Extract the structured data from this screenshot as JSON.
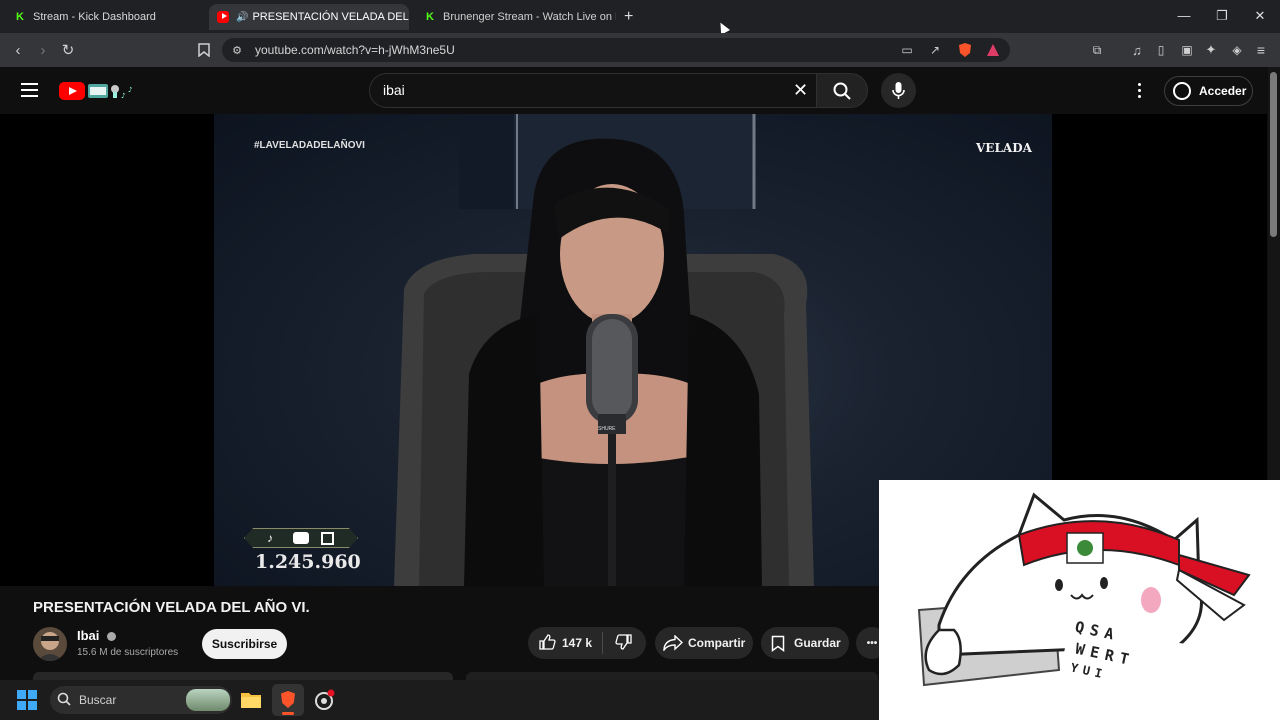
{
  "browser": {
    "tabs": [
      {
        "title": "Stream - Kick Dashboard",
        "icon": "kick-icon",
        "active": false
      },
      {
        "title": "PRESENTACIÓN VELADA DEL",
        "icon": "youtube-icon",
        "active": true
      },
      {
        "title": "Brunenger Stream - Watch Live on Ki",
        "icon": "kick-icon",
        "active": false
      }
    ],
    "new_tab": "+",
    "url": "youtube.com/watch?v=h-jWhM3ne5U",
    "window_controls": [
      "—",
      "❐",
      "✕"
    ]
  },
  "youtube": {
    "search_value": "ibai",
    "signin_label": "Acceder"
  },
  "video": {
    "hashtag": "#LAVELADADELAÑOVI",
    "logo_text": "VELADA",
    "counter": "1.245.960",
    "mic_brand": "SHURE"
  },
  "details": {
    "title": "PRESENTACIÓN VELADA DEL AÑO VI.",
    "channel_name": "Ibai",
    "subscribers": "15.6 M de suscriptores",
    "subscribe_label": "Suscribirse",
    "likes": "147 k",
    "share_label": "Compartir",
    "save_label": "Guardar",
    "more": "•••"
  },
  "overlay": {
    "keyboard_keys": [
      "Q",
      "S",
      "A",
      "W",
      "E",
      "R",
      "T",
      "Y",
      "U",
      "I"
    ]
  },
  "taskbar": {
    "search_label": "Buscar"
  },
  "colors": {
    "youtube_red": "#ff0000",
    "kick_green": "#53fc18",
    "peru_red": "#d91023"
  }
}
